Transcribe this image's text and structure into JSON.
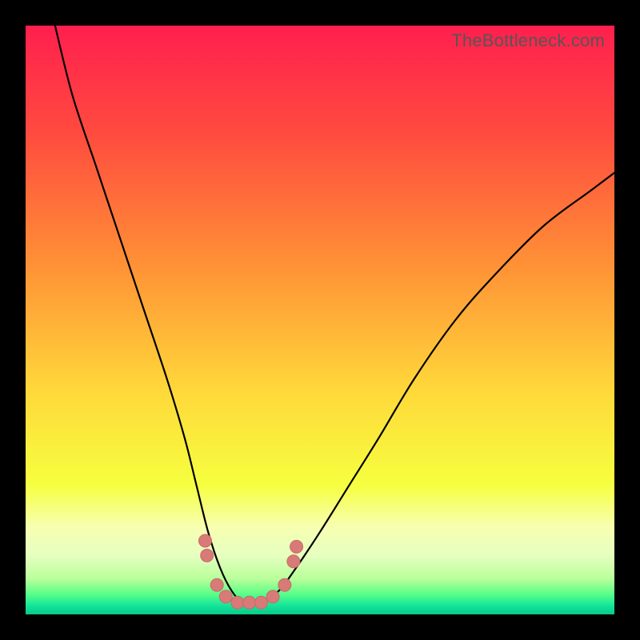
{
  "watermark": "TheBottleneck.com",
  "colors": {
    "frame": "#000000",
    "curve": "#000000",
    "markers_fill": "#d77a78",
    "markers_stroke": "#c96a68",
    "gradient_stops": [
      {
        "offset": 0.0,
        "color": "#ff1f4e"
      },
      {
        "offset": 0.18,
        "color": "#ff4a3f"
      },
      {
        "offset": 0.4,
        "color": "#ff8f36"
      },
      {
        "offset": 0.62,
        "color": "#ffd83a"
      },
      {
        "offset": 0.78,
        "color": "#f6ff3f"
      },
      {
        "offset": 0.85,
        "color": "#f7ffb0"
      },
      {
        "offset": 0.9,
        "color": "#e6ffc0"
      },
      {
        "offset": 0.94,
        "color": "#b8ff9a"
      },
      {
        "offset": 0.965,
        "color": "#5cff88"
      },
      {
        "offset": 0.985,
        "color": "#14e59a"
      },
      {
        "offset": 1.0,
        "color": "#09c98c"
      }
    ]
  },
  "chart_data": {
    "type": "line",
    "title": "",
    "xlabel": "",
    "ylabel": "",
    "xlim": [
      0,
      100
    ],
    "ylim": [
      0,
      100
    ],
    "series": [
      {
        "name": "bottleneck-curve",
        "x": [
          5,
          8,
          12,
          16,
          20,
          24,
          27,
          29,
          31,
          33,
          35,
          37,
          40,
          43,
          46,
          50,
          55,
          60,
          66,
          73,
          80,
          88,
          96,
          100
        ],
        "y": [
          100,
          88,
          76,
          64,
          52,
          40,
          30,
          22,
          14,
          8,
          4,
          2,
          2,
          4,
          8,
          14,
          22,
          30,
          40,
          50,
          58,
          66,
          72,
          75
        ]
      }
    ],
    "markers": [
      {
        "x": 30.5,
        "y": 12.5
      },
      {
        "x": 30.8,
        "y": 10.0
      },
      {
        "x": 32.5,
        "y": 5.0
      },
      {
        "x": 34.0,
        "y": 3.0
      },
      {
        "x": 36.0,
        "y": 2.0
      },
      {
        "x": 38.0,
        "y": 2.0
      },
      {
        "x": 40.0,
        "y": 2.0
      },
      {
        "x": 42.0,
        "y": 3.0
      },
      {
        "x": 44.0,
        "y": 5.0
      },
      {
        "x": 45.5,
        "y": 9.0
      },
      {
        "x": 46.0,
        "y": 11.5
      }
    ],
    "marker_radius_px": 8
  }
}
